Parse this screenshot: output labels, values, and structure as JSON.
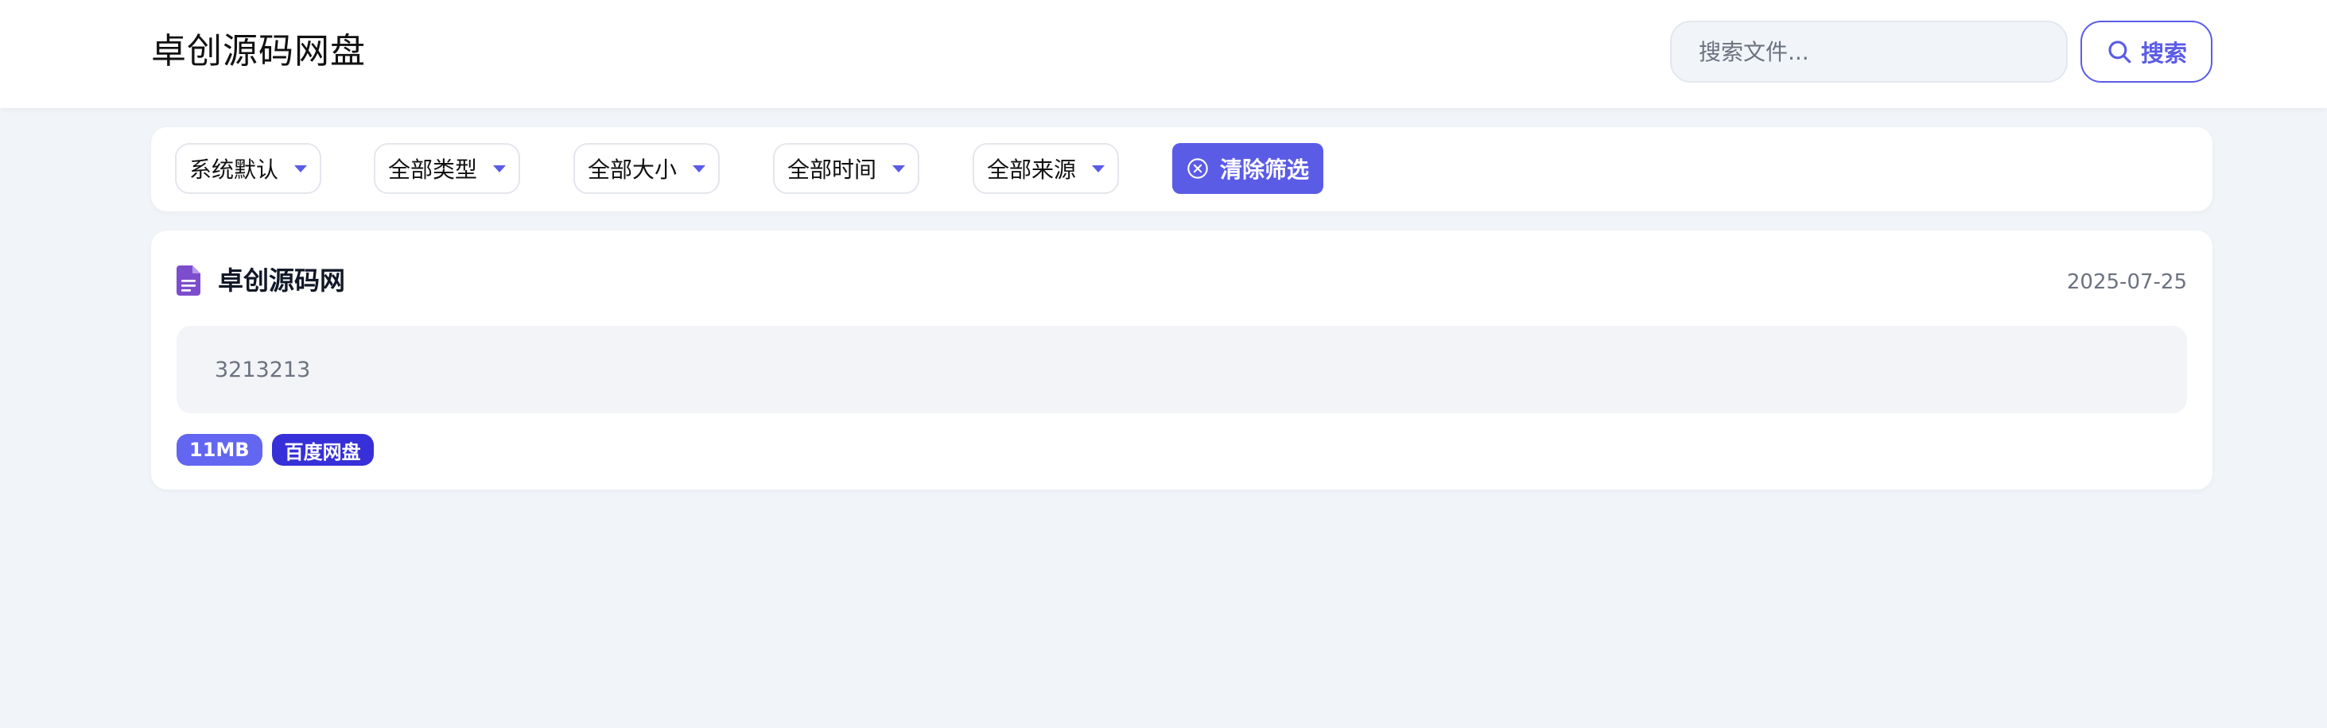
{
  "header": {
    "title": "卓创源码网盘",
    "search_placeholder": "搜索文件...",
    "search_button": "搜索"
  },
  "filters": {
    "items": [
      {
        "label": "系统默认"
      },
      {
        "label": "全部类型"
      },
      {
        "label": "全部大小"
      },
      {
        "label": "全部时间"
      },
      {
        "label": "全部来源"
      }
    ],
    "clear_button": "清除筛选"
  },
  "results": [
    {
      "title": "卓创源码网",
      "date": "2025-07-25",
      "description": "3213213",
      "tags": {
        "size": "11MB",
        "source": "百度网盘"
      }
    }
  ],
  "colors": {
    "accent": "#5b5ce6",
    "source_tag": "#3730d9",
    "file_icon": "#7c4dcc",
    "background": "#f1f4f8"
  },
  "icons": {
    "search": "search-icon",
    "clear": "close-circle-icon",
    "file": "document-icon",
    "dropdown": "caret-down-icon"
  }
}
